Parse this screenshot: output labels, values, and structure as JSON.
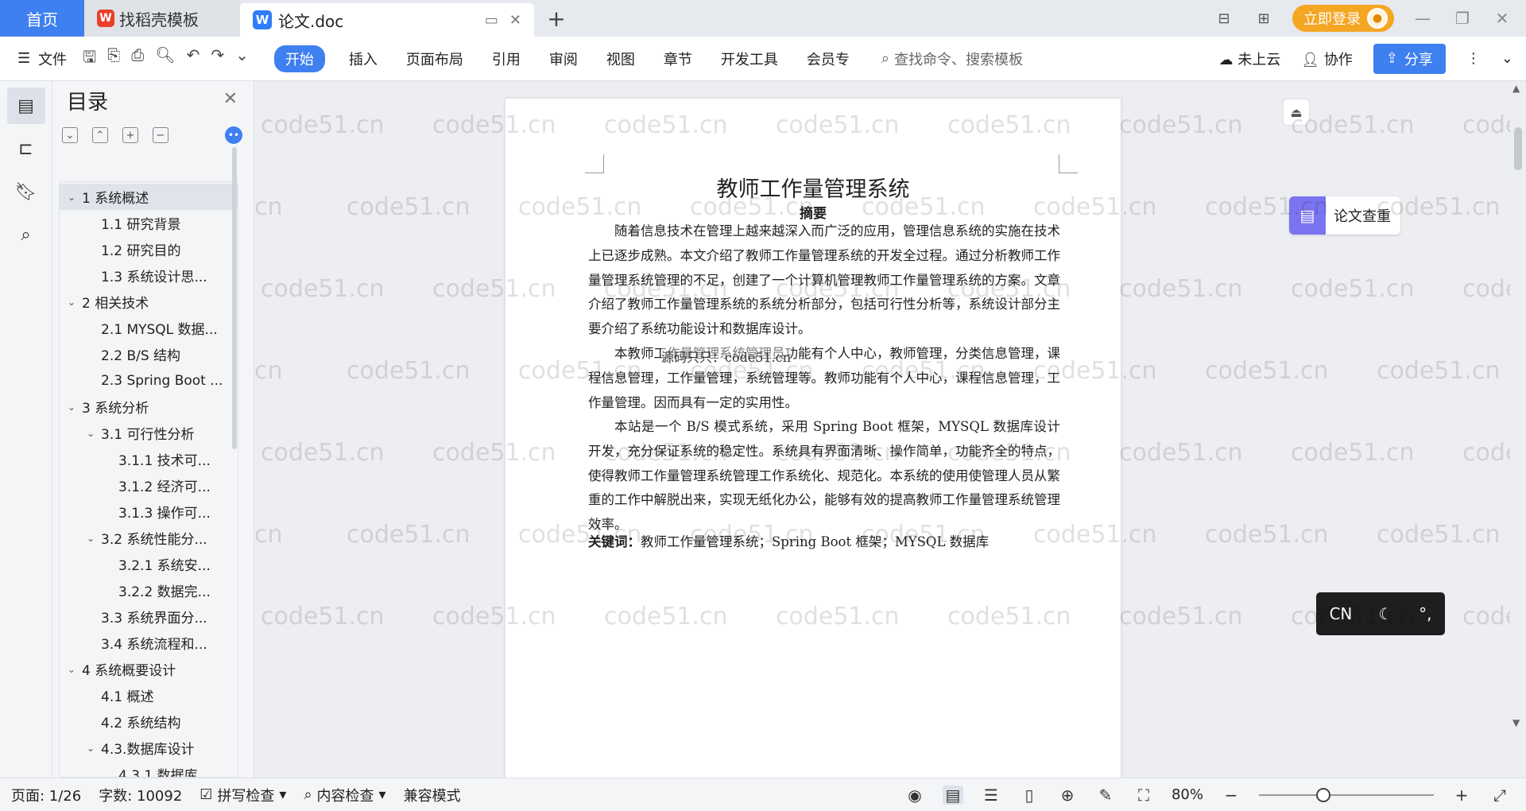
{
  "tabs": {
    "home": "首页",
    "template": "找稻壳模板",
    "doc": "论文.doc"
  },
  "titlebar": {
    "login": "立即登录"
  },
  "menu": {
    "file": "文件",
    "items": [
      "开始",
      "插入",
      "页面布局",
      "引用",
      "审阅",
      "视图",
      "章节",
      "开发工具",
      "会员专"
    ],
    "search_placeholder": "查找命令、搜索模板",
    "cloud": "未上云",
    "collab": "协作",
    "share": "分享"
  },
  "toc": {
    "title": "目录",
    "items": [
      {
        "label": "1 系统概述",
        "level": 1
      },
      {
        "label": "1.1  研究背景",
        "level": 2
      },
      {
        "label": "1.2 研究目的",
        "level": 2
      },
      {
        "label": "1.3 系统设计思...",
        "level": 2
      },
      {
        "label": "2 相关技术",
        "level": 1
      },
      {
        "label": "2.1 MYSQL 数据...",
        "level": 2
      },
      {
        "label": "2.2 B/S 结构",
        "level": 2
      },
      {
        "label": "2.3 Spring Boot ...",
        "level": 2
      },
      {
        "label": "3 系统分析",
        "level": 1
      },
      {
        "label": "3.1 可行性分析",
        "level": 2
      },
      {
        "label": "3.1.1 技术可...",
        "level": 3
      },
      {
        "label": "3.1.2 经济可...",
        "level": 3
      },
      {
        "label": "3.1.3 操作可...",
        "level": 3
      },
      {
        "label": "3.2 系统性能分...",
        "level": 2
      },
      {
        "label": "3.2.1  系统安...",
        "level": 3
      },
      {
        "label": "3.2.2  数据完...",
        "level": 3
      },
      {
        "label": "3.3 系统界面分...",
        "level": 2
      },
      {
        "label": "3.4 系统流程和...",
        "level": 2
      },
      {
        "label": "4 系统概要设计",
        "level": 1
      },
      {
        "label": "4.1 概述",
        "level": 2
      },
      {
        "label": "4.2 系统结构",
        "level": 2
      },
      {
        "label": "4.3.数据库设计",
        "level": 2
      },
      {
        "label": "4.3.1 数据库...",
        "level": 3
      }
    ]
  },
  "document": {
    "title": "教师工作量管理系统",
    "abstract_title": "摘要",
    "p1": "随着信息技术在管理上越来越深入而广泛的应用，管理信息系统的实施在技术上已逐步成熟。本文介绍了教师工作量管理系统的开发全过程。通过分析教师工作量管理系统管理的不足，创建了一个计算机管理教师工作量管理系统的方案。文章介绍了教师工作量管理系统的系统分析部分，包括可行性分析等，系统设计部分主要介绍了系统功能设计和数据库设计。",
    "p2": "本教师工作量管理系统管理员功能有个人中心，教师管理，分类信息管理，课程信息管理，工作量管理，系统管理等。教师功能有个人中心，课程信息管理，工作量管理。因而具有一定的实用性。",
    "p3": "本站是一个 B/S 模式系统，采用 Spring Boot 框架，MYSQL 数据库设计开发，充分保证系统的稳定性。系统具有界面清晰、操作简单，功能齐全的特点，使得教师工作量管理系统管理工作系统化、规范化。本系统的使用使管理人员从繁重的工作中解脱出来，实现无纸化办公，能够有效的提高教师工作量管理系统管理效率。",
    "keywords_label": "关键词：",
    "keywords": "教师工作量管理系统；Spring Boot 框架；MYSQL 数据库",
    "overlay": "源码只只：code51.cn"
  },
  "watermark": "code51.cn",
  "side_tools": {
    "paper_check": "论文查重"
  },
  "ime": {
    "lang": "CN"
  },
  "status": {
    "page": "页面: 1/26",
    "words": "字数: 10092",
    "spell": "拼写检查",
    "content": "内容检查",
    "compat": "兼容模式",
    "zoom": "80%"
  }
}
